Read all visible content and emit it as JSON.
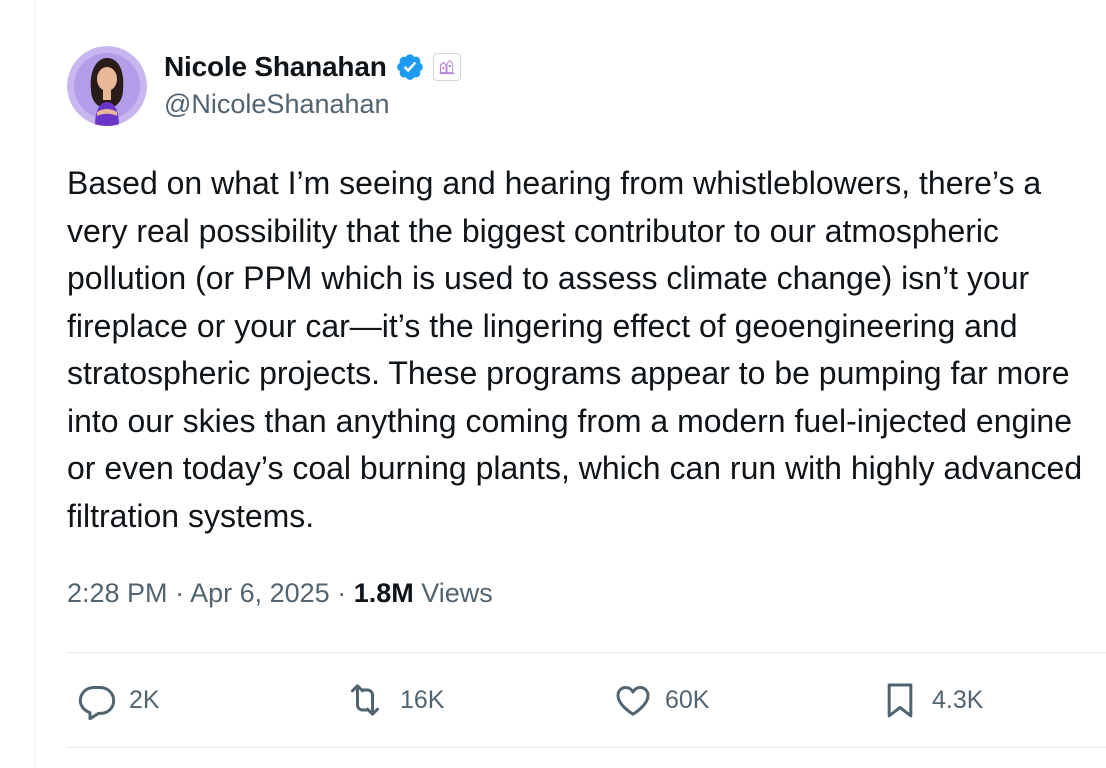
{
  "author": {
    "display_name": "Nicole Shanahan",
    "handle": "@NicoleShanahan",
    "verified_badge": "verified-badge-icon",
    "affiliate_badge": "affiliate-badge-icon"
  },
  "tweet": {
    "lines": [
      "Based on what I’m seeing and hearing from whistleblowers, there’s a",
      "very real possibility that the biggest contributor to our atmospheric",
      "pollution (or PPM which is used to assess climate change) isn’t your",
      "fireplace or your car—it’s the lingering effect of geoengineering and",
      "stratospheric projects. These programs appear to be pumping far more",
      "into our skies than anything coming from a modern fuel-injected engine",
      "or even today’s coal burning plants, which can run with highly advanced",
      "filtration systems."
    ]
  },
  "meta": {
    "time": "2:28 PM",
    "separator": "·",
    "date": "Apr 6, 2025",
    "views_count": "1.8M",
    "views_label": "Views"
  },
  "actions": {
    "replies": "2K",
    "reposts": "16K",
    "likes": "60K",
    "bookmarks": "4.3K"
  },
  "colors": {
    "text": "#0f1419",
    "secondary": "#536471",
    "verified": "#1d9bf0",
    "divider": "#e6ecf0",
    "avatar_bg": "#c7b6f0"
  },
  "icons": [
    "reply-icon",
    "repost-icon",
    "like-icon",
    "bookmark-icon"
  ]
}
